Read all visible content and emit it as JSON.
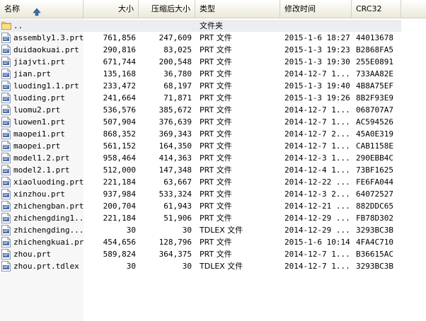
{
  "columns": {
    "name": "名称",
    "size": "大小",
    "compressed": "压缩后大小",
    "type": "类型",
    "modified": "修改时间",
    "crc": "CRC32"
  },
  "parent": {
    "name": "..",
    "type": "文件夹"
  },
  "files": [
    {
      "name": "assembly1.3.prt",
      "size": "761,856",
      "compressed": "247,609",
      "type": "PRT 文件",
      "modified": "2015-1-6 18:27",
      "crc": "44013678"
    },
    {
      "name": "duidaokuai.prt",
      "size": "290,816",
      "compressed": "83,025",
      "type": "PRT 文件",
      "modified": "2015-1-3 19:23",
      "crc": "B2868FA5"
    },
    {
      "name": "jiajvti.prt",
      "size": "671,744",
      "compressed": "200,548",
      "type": "PRT 文件",
      "modified": "2015-1-3 19:30",
      "crc": "255E0891"
    },
    {
      "name": "jian.prt",
      "size": "135,168",
      "compressed": "36,780",
      "type": "PRT 文件",
      "modified": "2014-12-7 1...",
      "crc": "733AA82E"
    },
    {
      "name": "luoding1.1.prt",
      "size": "233,472",
      "compressed": "68,197",
      "type": "PRT 文件",
      "modified": "2015-1-3 19:40",
      "crc": "4B8A75EF"
    },
    {
      "name": "luoding.prt",
      "size": "241,664",
      "compressed": "71,871",
      "type": "PRT 文件",
      "modified": "2015-1-3 19:26",
      "crc": "8B2F93E9"
    },
    {
      "name": "luomu2.prt",
      "size": "536,576",
      "compressed": "385,672",
      "type": "PRT 文件",
      "modified": "2014-12-7 1...",
      "crc": "068707A7"
    },
    {
      "name": "luowen1.prt",
      "size": "507,904",
      "compressed": "376,639",
      "type": "PRT 文件",
      "modified": "2014-12-7 1...",
      "crc": "AC594526"
    },
    {
      "name": "maopei1.prt",
      "size": "868,352",
      "compressed": "369,343",
      "type": "PRT 文件",
      "modified": "2014-12-7 2...",
      "crc": "45A0E319"
    },
    {
      "name": "maopei.prt",
      "size": "561,152",
      "compressed": "164,350",
      "type": "PRT 文件",
      "modified": "2014-12-7 1...",
      "crc": "CAB1158E"
    },
    {
      "name": "model1.2.prt",
      "size": "958,464",
      "compressed": "414,363",
      "type": "PRT 文件",
      "modified": "2014-12-3 1...",
      "crc": "290EBB4C"
    },
    {
      "name": "model2.1.prt",
      "size": "512,000",
      "compressed": "147,348",
      "type": "PRT 文件",
      "modified": "2014-12-4 1...",
      "crc": "73BF1625"
    },
    {
      "name": "xiaoluoding.prt",
      "size": "221,184",
      "compressed": "63,667",
      "type": "PRT 文件",
      "modified": "2014-12-22 ...",
      "crc": "FE6FA044"
    },
    {
      "name": "xinzhou.prt",
      "size": "937,984",
      "compressed": "533,324",
      "type": "PRT 文件",
      "modified": "2014-12-3 2...",
      "crc": "64072527"
    },
    {
      "name": "zhichengban.prt",
      "size": "200,704",
      "compressed": "61,943",
      "type": "PRT 文件",
      "modified": "2014-12-21 ...",
      "crc": "882DDC65"
    },
    {
      "name": "zhichengding1...",
      "size": "221,184",
      "compressed": "51,906",
      "type": "PRT 文件",
      "modified": "2014-12-29 ...",
      "crc": "FB78D302"
    },
    {
      "name": "zhichengding....",
      "size": "30",
      "compressed": "30",
      "type": "TDLEX 文件",
      "modified": "2014-12-29 ...",
      "crc": "3293BC3B"
    },
    {
      "name": "zhichengkuai.prt",
      "size": "454,656",
      "compressed": "128,796",
      "type": "PRT 文件",
      "modified": "2015-1-6 10:14",
      "crc": "4FA4C710"
    },
    {
      "name": "zhou.prt",
      "size": "589,824",
      "compressed": "364,375",
      "type": "PRT 文件",
      "modified": "2014-12-7 1...",
      "crc": "B36615AC"
    },
    {
      "name": "zhou.prt.tdlex",
      "size": "30",
      "compressed": "30",
      "type": "TDLEX 文件",
      "modified": "2014-12-7 1...",
      "crc": "3293BC3B"
    }
  ],
  "icons": {
    "sort": "sort-ascending-icon",
    "folder": "folder-icon",
    "file": "file-icon"
  }
}
